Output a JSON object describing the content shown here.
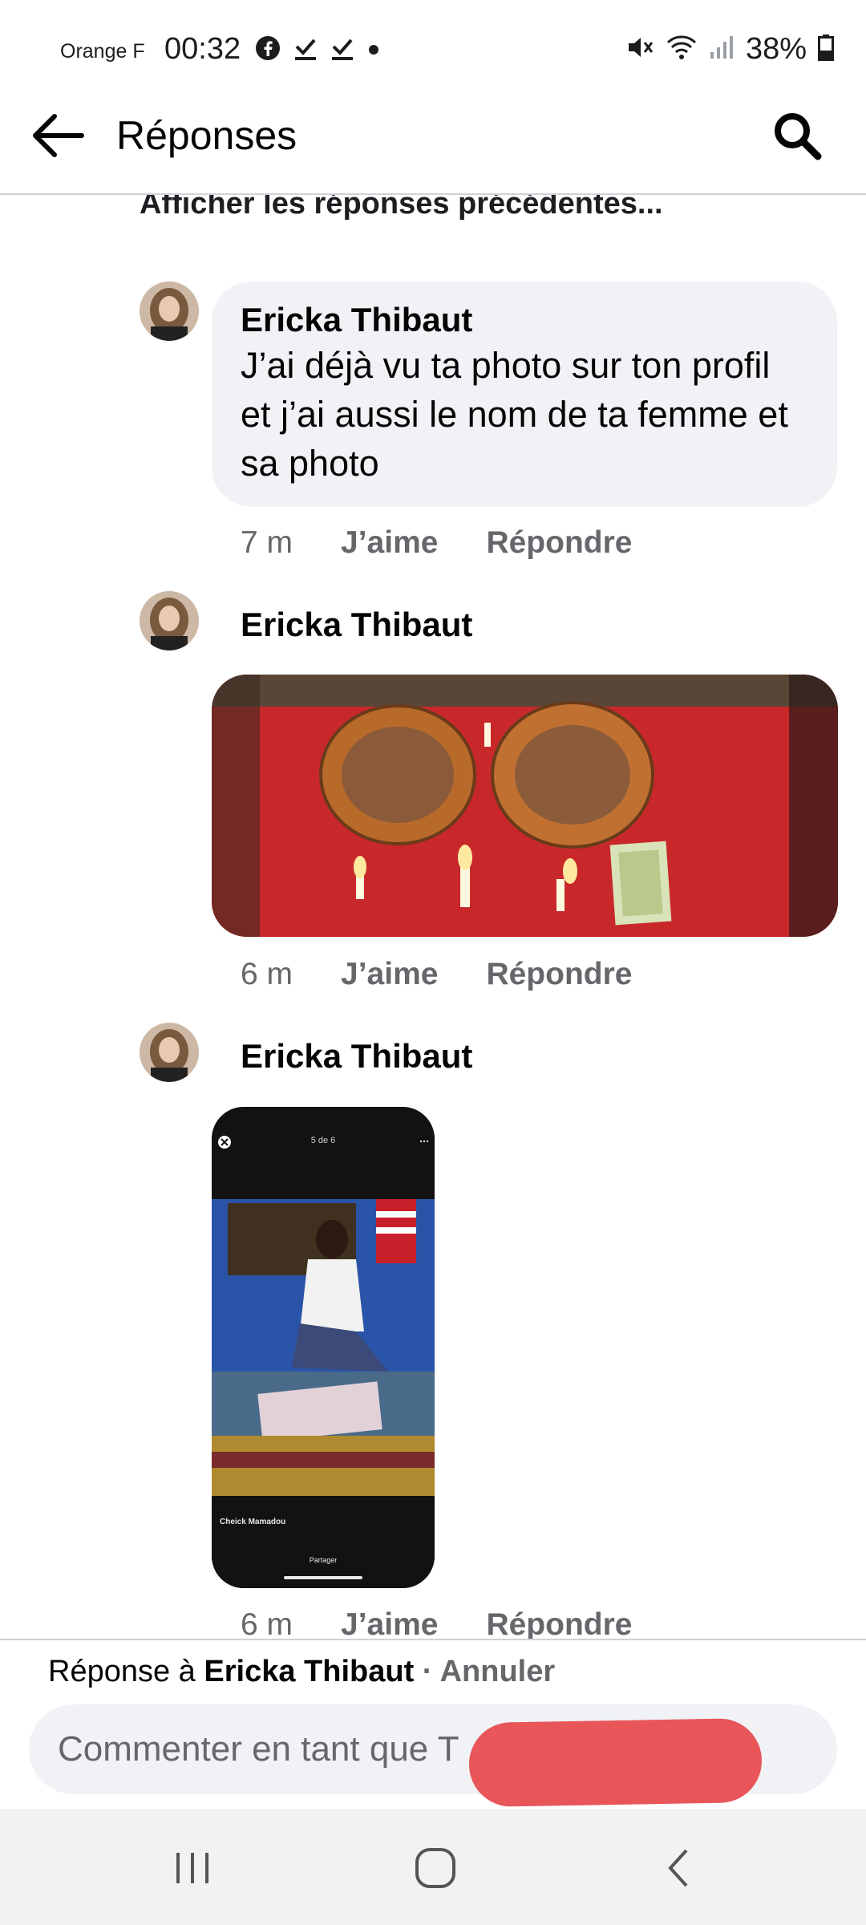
{
  "status_bar": {
    "carrier": "Orange F",
    "time": "00:32",
    "battery": "38%",
    "icons": [
      "facebook-icon",
      "download-done-icon",
      "download-done-icon",
      "dot-icon",
      "mute-icon",
      "wifi-icon",
      "signal-icon",
      "battery-icon"
    ]
  },
  "header": {
    "title": "Réponses",
    "back_icon": "arrow-left-icon",
    "search_icon": "search-icon"
  },
  "previous_replies": "Afficher les réponses précédentes...",
  "comments": [
    {
      "author": "Ericka Thibaut",
      "text": "J’ai déjà vu ta photo sur ton profil et j’ai aussi le nom de ta femme et sa photo",
      "time": "7 m",
      "like_label": "J’aime",
      "reply_label": "Répondre"
    },
    {
      "author": "Ericka Thibaut",
      "time": "6 m",
      "like_label": "J’aime",
      "reply_label": "Répondre"
    },
    {
      "author": "Ericka Thibaut",
      "screenshot": {
        "counter": "5 de 6",
        "caption_name": "Cheick Mamadou",
        "share_label": "Partager"
      },
      "time": "6 m",
      "like_label": "J’aime",
      "reply_label": "Répondre"
    }
  ],
  "reply_bar": {
    "prefix": "Réponse à ",
    "name": "Ericka Thibaut",
    "separator": " · ",
    "cancel": "Annuler",
    "placeholder": "Commenter en tant que T"
  },
  "colors": {
    "bubble": "#f0f2f5",
    "meta_text": "#65676b",
    "redaction": "#e8565a"
  }
}
